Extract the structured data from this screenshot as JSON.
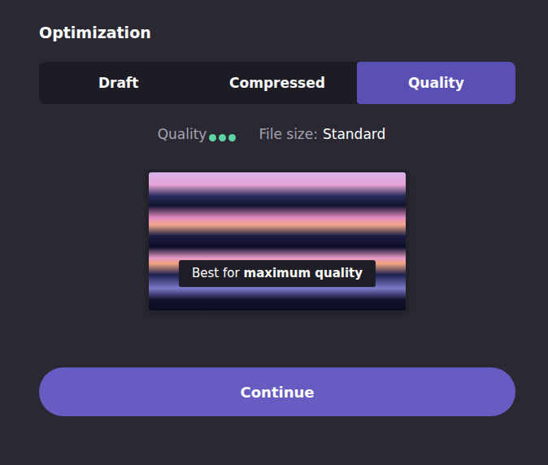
{
  "section": {
    "title": "Optimization"
  },
  "tabs": [
    {
      "label": "Draft",
      "selected": false
    },
    {
      "label": "Compressed",
      "selected": false
    },
    {
      "label": "Quality",
      "selected": true
    }
  ],
  "info": {
    "quality_label": "Quality",
    "quality_level": {
      "filled": 3,
      "total": 3
    },
    "file_size_label": "File size:",
    "file_size_value": "Standard"
  },
  "preview": {
    "caption_prefix": "Best for",
    "caption_emphasis": "maximum quality"
  },
  "buttons": [
    "Continue"
  ]
}
